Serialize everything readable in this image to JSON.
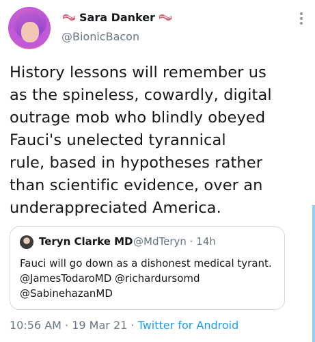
{
  "author": {
    "display_name": "Sara Danker",
    "handle": "@BionicBacon",
    "left_icon": "bacon-icon",
    "right_icon": "bacon-icon"
  },
  "tweet": {
    "lines": [
      "History lessons will remember us",
      "as the spineless, cowardly, digital",
      "outrage mob who blindly obeyed",
      "Fauci's unelected tyrannical",
      "rule, based in hypotheses rather",
      "than scientific evidence, over an",
      "underappreciated America."
    ]
  },
  "quoted": {
    "display_name": "Teryn Clarke MD",
    "handle": "@MdTeryn",
    "separator": "·",
    "time": "14h",
    "lines": [
      "Fauci will go down as a dishonest medical tyrant.",
      "@JamesTodaroMD @richardursomd",
      "@SabinehazanMD"
    ]
  },
  "footer": {
    "time": "10:56 AM",
    "sep1": "·",
    "date": "19 Mar 21",
    "sep2": "·",
    "app": "Twitter for Android"
  },
  "colors": {
    "link": "#1d9bf0",
    "secondary_text": "#687684",
    "border": "#cfd9de"
  }
}
